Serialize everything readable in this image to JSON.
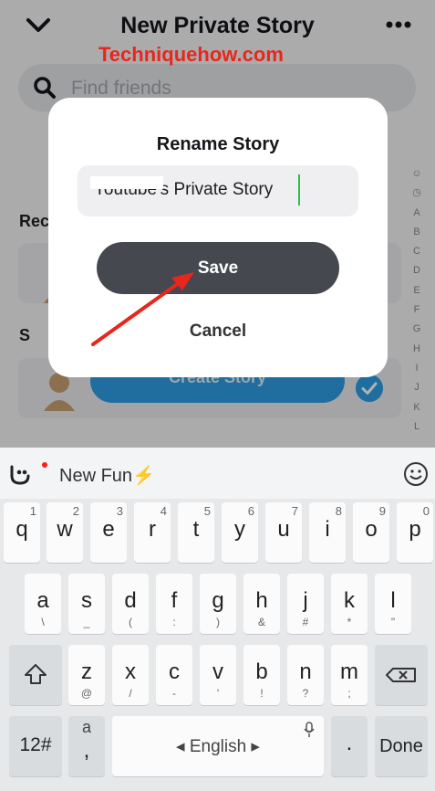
{
  "header": {
    "title": "New Private Story"
  },
  "watermark": "Techniquehow.com",
  "search": {
    "placeholder": "Find friends"
  },
  "sections": {
    "recents_label": "Rec",
    "s_label": "S"
  },
  "create_button": "Create Story",
  "alphabet": [
    "A",
    "B",
    "C",
    "D",
    "E",
    "F",
    "G",
    "H",
    "I",
    "J",
    "K",
    "L"
  ],
  "dialog": {
    "title": "Rename Story",
    "story_name": "Youtube's Private Story",
    "save_label": "Save",
    "cancel_label": "Cancel"
  },
  "keyboard": {
    "suggestion": "New Fun⚡",
    "row1": [
      {
        "k": "q",
        "h": "1"
      },
      {
        "k": "w",
        "h": "2"
      },
      {
        "k": "e",
        "h": "3"
      },
      {
        "k": "r",
        "h": "4"
      },
      {
        "k": "t",
        "h": "5"
      },
      {
        "k": "y",
        "h": "6"
      },
      {
        "k": "u",
        "h": "7"
      },
      {
        "k": "i",
        "h": "8"
      },
      {
        "k": "o",
        "h": "9"
      },
      {
        "k": "p",
        "h": "0"
      }
    ],
    "row2": [
      {
        "k": "a",
        "b": "\\"
      },
      {
        "k": "s",
        "b": "_"
      },
      {
        "k": "d",
        "b": "("
      },
      {
        "k": "f",
        "b": ":"
      },
      {
        "k": "g",
        "b": ")"
      },
      {
        "k": "h",
        "b": "&"
      },
      {
        "k": "j",
        "b": "#"
      },
      {
        "k": "k",
        "b": "*"
      },
      {
        "k": "l",
        "b": "\""
      }
    ],
    "row3": [
      {
        "k": "z",
        "b": "@"
      },
      {
        "k": "x",
        "b": "/"
      },
      {
        "k": "c",
        "b": "-"
      },
      {
        "k": "v",
        "b": "'"
      },
      {
        "k": "b",
        "b": "!"
      },
      {
        "k": "n",
        "b": "?"
      },
      {
        "k": "m",
        "b": ";"
      }
    ],
    "numbers_label": "12#",
    "comma_key_top": "a",
    "comma_key_bottom": ",",
    "space_label": "English",
    "period_label": ".",
    "done_label": "Done"
  },
  "colors": {
    "accent_blue": "#2e9ee6",
    "save_button": "#45484e",
    "watermark_red": "#e8261c",
    "caret_green": "#27c04a"
  }
}
